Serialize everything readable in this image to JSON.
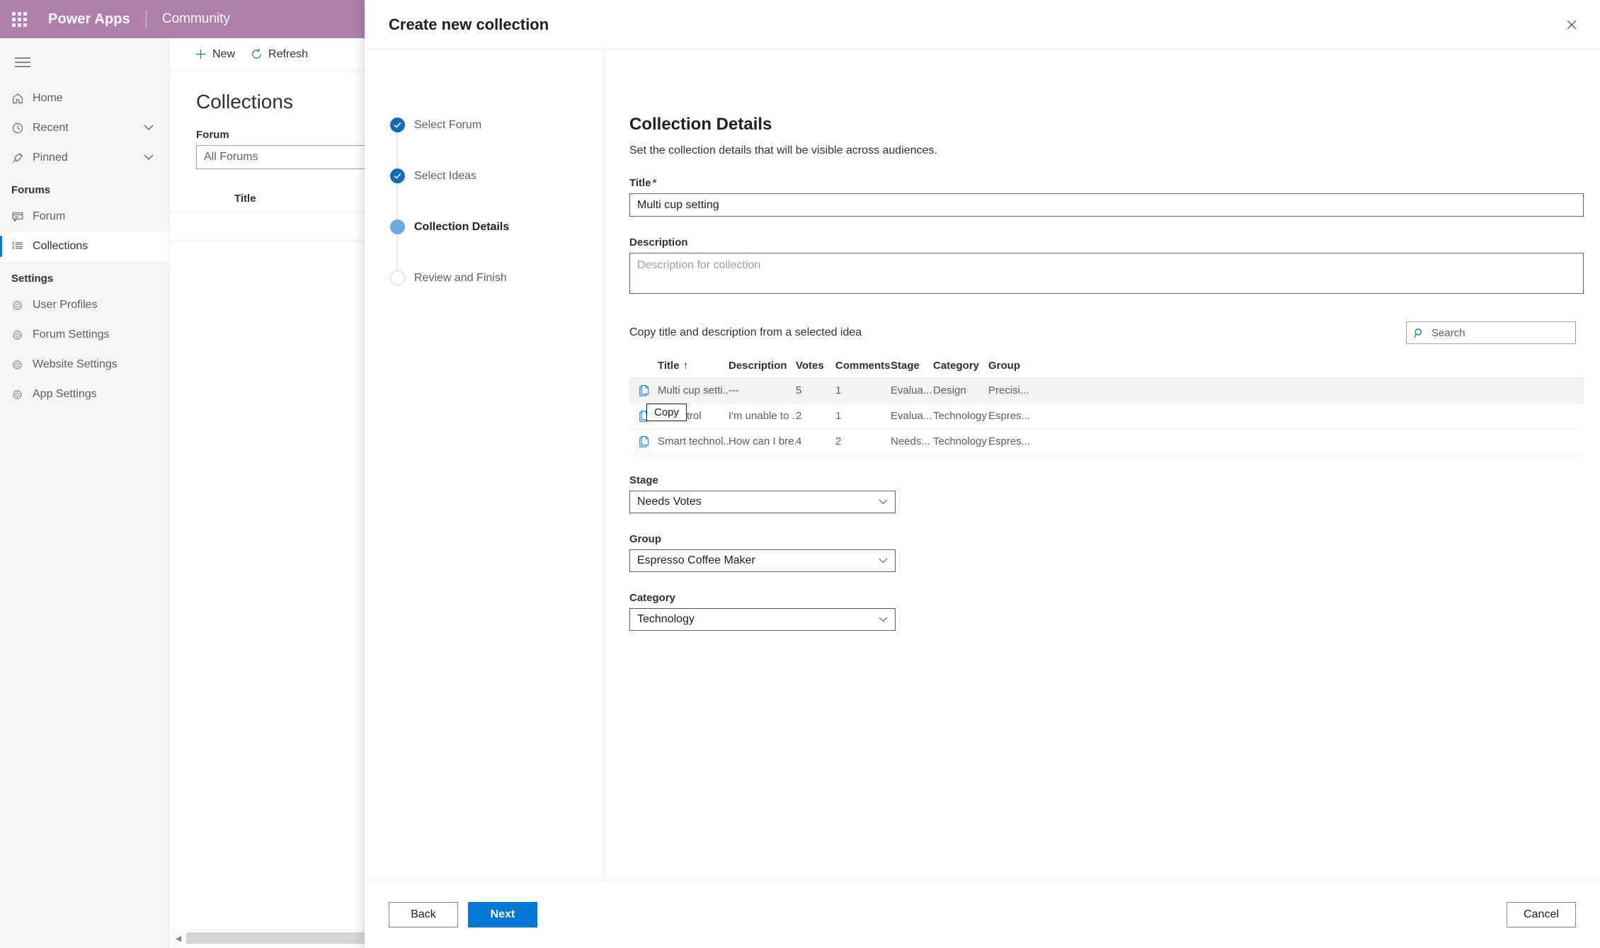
{
  "topbar": {
    "waffle_icon": "app-launcher-icon",
    "brand": "Power Apps",
    "app_name": "Community"
  },
  "sidebar": {
    "hamburger_icon": "hamburger-icon",
    "items": [
      {
        "label": "Home",
        "icon": "home-icon",
        "chevron": false,
        "selected": false
      },
      {
        "label": "Recent",
        "icon": "clock-icon",
        "chevron": true,
        "selected": false
      },
      {
        "label": "Pinned",
        "icon": "pin-icon",
        "chevron": true,
        "selected": false
      }
    ],
    "forums_section": "Forums",
    "forum_items": [
      {
        "label": "Forum",
        "icon": "forum-icon",
        "selected": false
      },
      {
        "label": "Collections",
        "icon": "list-icon",
        "selected": true
      }
    ],
    "settings_section": "Settings",
    "settings_items": [
      {
        "label": "User Profiles",
        "icon": "gear-icon"
      },
      {
        "label": "Forum Settings",
        "icon": "gear-icon"
      },
      {
        "label": "Website Settings",
        "icon": "gear-icon"
      },
      {
        "label": "App Settings",
        "icon": "gear-icon"
      }
    ]
  },
  "background": {
    "commands": [
      {
        "label": "New",
        "icon": "plus-icon"
      },
      {
        "label": "Refresh",
        "icon": "refresh-icon"
      }
    ],
    "page_title": "Collections",
    "filter_label": "Forum",
    "filter_value": "All Forums",
    "table_header": "Title"
  },
  "modal": {
    "title": "Create new collection",
    "close_icon": "close-icon",
    "steps": [
      {
        "label": "Select Forum",
        "state": "done"
      },
      {
        "label": "Select Ideas",
        "state": "done"
      },
      {
        "label": "Collection Details",
        "state": "current"
      },
      {
        "label": "Review and Finish",
        "state": "todo"
      }
    ],
    "pane": {
      "heading": "Collection Details",
      "subheading": "Set the collection details that will be visible across audiences.",
      "title_label": "Title",
      "title_required": "*",
      "title_value": "Multi cup setting",
      "description_label": "Description",
      "description_value": "",
      "description_placeholder": "Description for collection",
      "copy_label": "Copy title and description from a selected idea",
      "search_placeholder": "Search",
      "search_value": "",
      "search_icon": "search-icon",
      "tooltip": "Copy"
    },
    "table": {
      "columns": [
        "Title",
        "Description",
        "Votes",
        "Comments",
        "Stage",
        "Category",
        "Group"
      ],
      "sort_column": "Title",
      "sort_indicator": "↑",
      "row_icon": "copy-icon",
      "rows": [
        {
          "title": "Multi cup setti...",
          "description": "---",
          "votes": "5",
          "comments": "1",
          "stage": "Evalua...",
          "category": "Design",
          "group": "Precisi...",
          "selected": true
        },
        {
          "title": "te control",
          "description": "I'm unable to ...",
          "votes": "2",
          "comments": "1",
          "stage": "Evalua...",
          "category": "Technology",
          "group": "Espres...",
          "selected": false
        },
        {
          "title": "Smart technol...",
          "description": "How can I bre...",
          "votes": "4",
          "comments": "2",
          "stage": "Needs...",
          "category": "Technology",
          "group": "Espres...",
          "selected": false
        }
      ]
    },
    "selects": [
      {
        "label": "Stage",
        "value": "Needs Votes",
        "icon": "chevron-down-icon"
      },
      {
        "label": "Group",
        "value": "Espresso Coffee Maker",
        "icon": "chevron-down-icon"
      },
      {
        "label": "Category",
        "value": "Technology",
        "icon": "chevron-down-icon"
      }
    ],
    "footer": {
      "back": "Back",
      "next": "Next",
      "cancel": "Cancel"
    }
  },
  "colors": {
    "brand_purple": "#b07fab",
    "accent_blue": "#0078d4",
    "step_done": "#0f6cbd",
    "step_current": "#6aa9e0",
    "required_red": "#a4262c"
  }
}
